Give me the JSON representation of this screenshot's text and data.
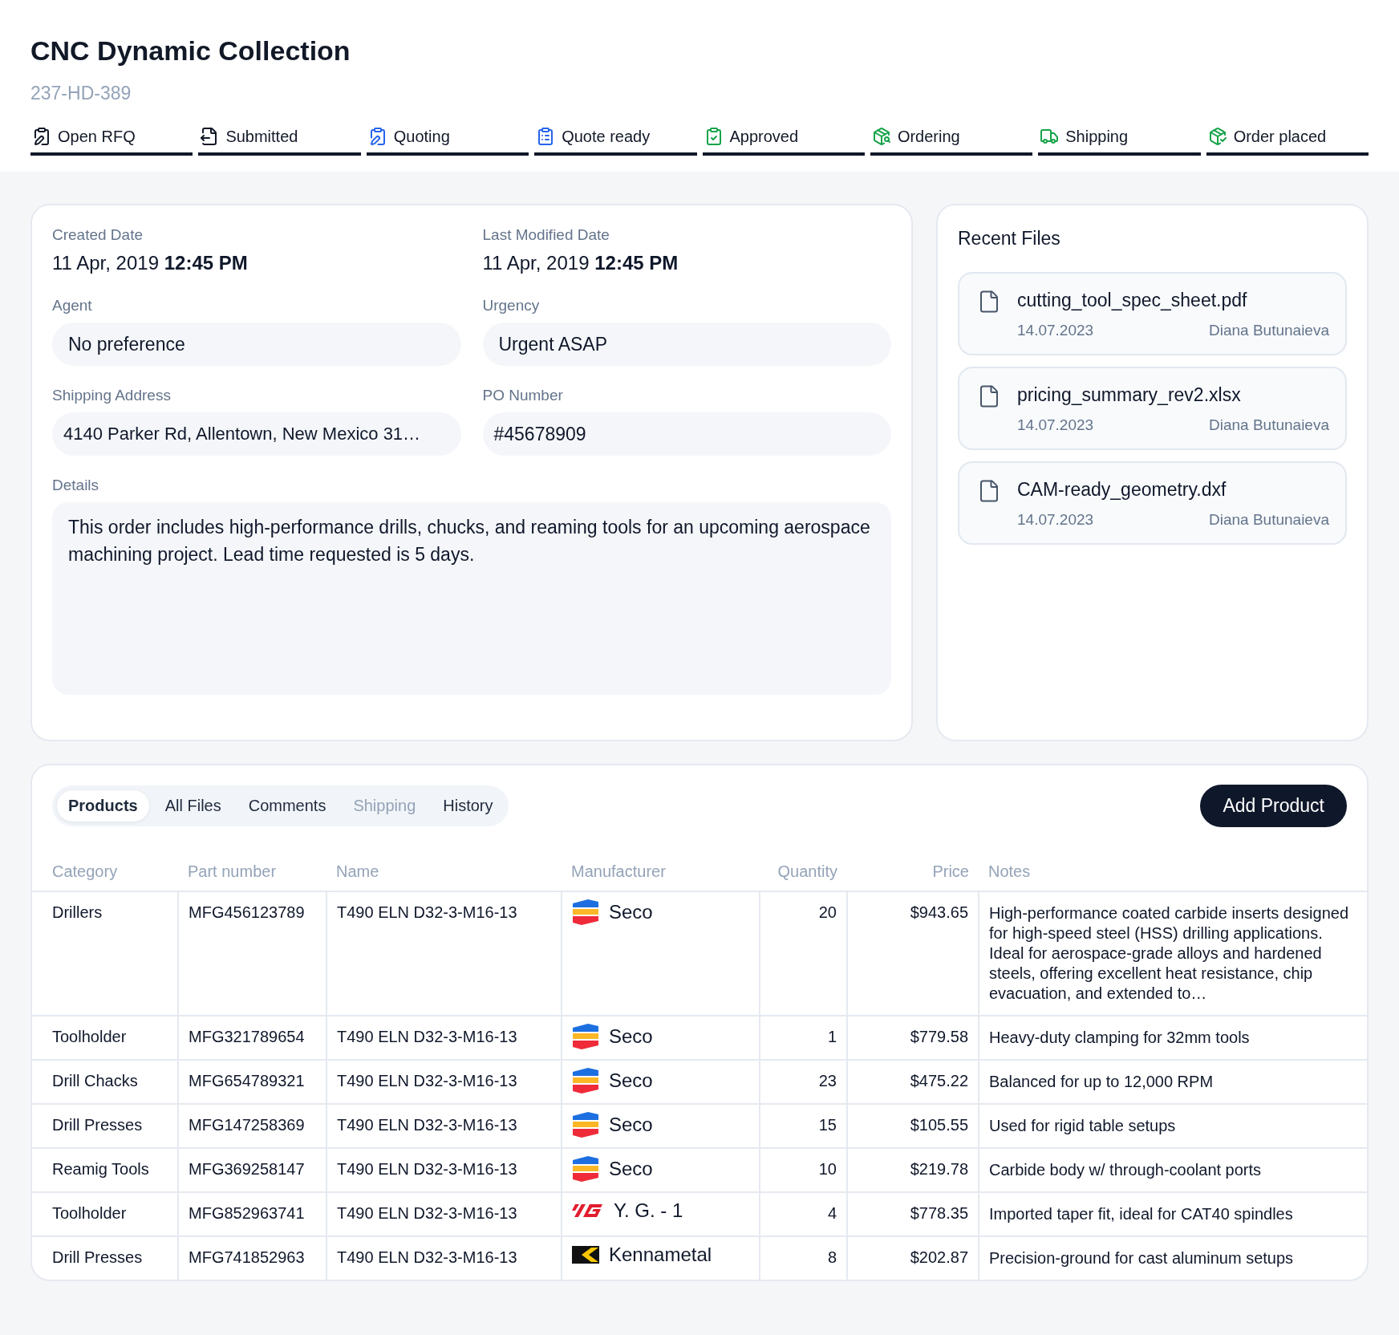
{
  "header": {
    "title": "CNC Dynamic Collection",
    "code": "237-HD-389"
  },
  "stages": [
    {
      "label": "Open RFQ",
      "color": "#111827"
    },
    {
      "label": "Submitted",
      "color": "#111827"
    },
    {
      "label": "Quoting",
      "color": "#2563eb"
    },
    {
      "label": "Quote ready",
      "color": "#2563eb"
    },
    {
      "label": "Approved",
      "color": "#16a34a"
    },
    {
      "label": "Ordering",
      "color": "#16a34a"
    },
    {
      "label": "Shipping",
      "color": "#16a34a"
    },
    {
      "label": "Order placed",
      "color": "#16a34a"
    }
  ],
  "details": {
    "created": {
      "label": "Created Date",
      "value": "11 Apr, 2019 **12:45 PM**"
    },
    "modified": {
      "label": "Last Modified Date",
      "value": "11 Apr, 2019 **12:45 PM**"
    },
    "agent": {
      "label": "Agent",
      "value": "No preference"
    },
    "urgency": {
      "label": "Urgency",
      "value": "Urgent ASAP"
    },
    "address": {
      "label": "Shipping Address",
      "value": "4140 Parker Rd, Allentown, New Mexico 31…"
    },
    "po": {
      "label": "PO Number",
      "value": "#45678909"
    },
    "notes": {
      "label": "Details",
      "value": "This order includes high-performance drills, chucks, and reaming tools for an upcoming aerospace machining project. Lead time requested is 5 days."
    }
  },
  "recent_files": {
    "title": "Recent Files",
    "files": [
      {
        "name": "cutting_tool_spec_sheet.pdf",
        "date": "14.07.2023",
        "author": "Diana Butunaieva"
      },
      {
        "name": "pricing_summary_rev2.xlsx",
        "date": "14.07.2023",
        "author": "Diana Butunaieva"
      },
      {
        "name": "CAM-ready_geometry.dxf",
        "date": "14.07.2023",
        "author": "Diana Butunaieva"
      }
    ]
  },
  "tabs": [
    {
      "label": "Products",
      "selected": true,
      "disabled": false
    },
    {
      "label": "All Files",
      "selected": false,
      "disabled": false
    },
    {
      "label": "Comments",
      "selected": false,
      "disabled": false
    },
    {
      "label": "Shipping",
      "selected": false,
      "disabled": true
    },
    {
      "label": "History",
      "selected": false,
      "disabled": false
    }
  ],
  "add_button": "Add Product",
  "table": {
    "columns": [
      "Category",
      "Part number",
      "Name",
      "Manufacturer",
      "Quantity",
      "Price",
      "Notes"
    ],
    "rows": [
      {
        "category": "Drillers",
        "part": "MFG456123789",
        "name": "T490 ELN D32-3-M16-13",
        "manufacturer": {
          "kind": "seco",
          "name": "Seco"
        },
        "quantity": "20",
        "price": "$943.65",
        "notes": "High-performance coated carbide inserts designed for high-speed steel (HSS) drilling applications. Ideal for aerospace-grade alloys and hardened steels, offering excellent heat resistance, chip evacuation, and extended to…"
      },
      {
        "category": "Toolholder",
        "part": "MFG321789654",
        "name": "T490 ELN D32-3-M16-13",
        "manufacturer": {
          "kind": "seco",
          "name": "Seco"
        },
        "quantity": "1",
        "price": "$779.58",
        "notes": "Heavy-duty clamping for 32mm tools"
      },
      {
        "category": "Drill Chacks",
        "part": "MFG654789321",
        "name": "T490 ELN D32-3-M16-13",
        "manufacturer": {
          "kind": "seco",
          "name": "Seco"
        },
        "quantity": "23",
        "price": "$475.22",
        "notes": "Balanced for up to 12,000 RPM"
      },
      {
        "category": "Drill Presses",
        "part": "MFG147258369",
        "name": "T490 ELN D32-3-M16-13",
        "manufacturer": {
          "kind": "seco",
          "name": "Seco"
        },
        "quantity": "15",
        "price": "$105.55",
        "notes": "Used for rigid table setups"
      },
      {
        "category": "Reamig Tools",
        "part": "MFG369258147",
        "name": "T490 ELN D32-3-M16-13",
        "manufacturer": {
          "kind": "seco",
          "name": "Seco"
        },
        "quantity": "10",
        "price": "$219.78",
        "notes": "Carbide body w/ through-coolant ports"
      },
      {
        "category": "Toolholder",
        "part": "MFG852963741",
        "name": "T490 ELN D32-3-M16-13",
        "manufacturer": {
          "kind": "yg",
          "name": "Y. G. - 1"
        },
        "quantity": "4",
        "price": "$778.35",
        "notes": "Imported taper fit, ideal for CAT40 spindles"
      },
      {
        "category": "Drill Presses",
        "part": "MFG741852963",
        "name": "T490 ELN D32-3-M16-13",
        "manufacturer": {
          "kind": "kennametal",
          "name": "Kennametal"
        },
        "quantity": "8",
        "price": "$202.87",
        "notes": "Precision-ground for cast aluminum setups"
      }
    ]
  }
}
